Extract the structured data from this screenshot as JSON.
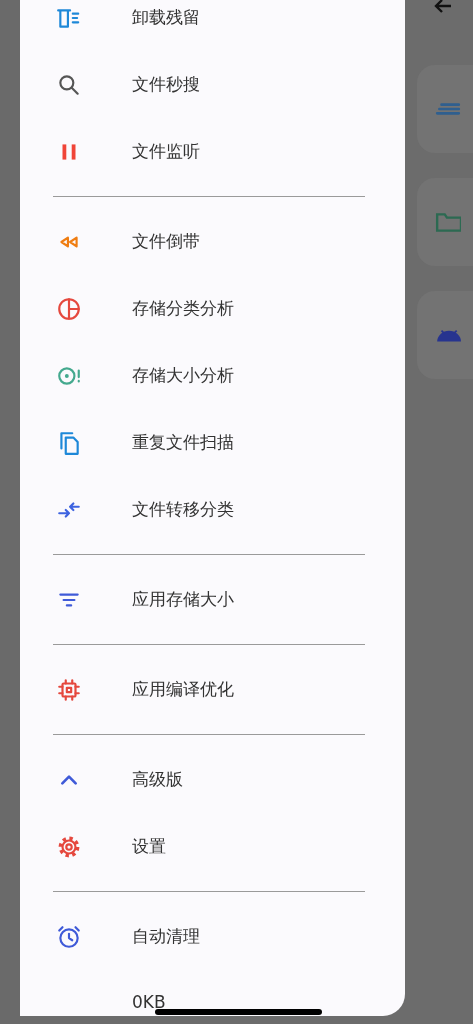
{
  "drawer": {
    "sections": [
      {
        "items": [
          {
            "kind": "uninstall",
            "color": "#1e88d8",
            "label": "卸载残留"
          },
          {
            "kind": "search",
            "color": "#555555",
            "label": "文件秒搜"
          },
          {
            "kind": "pause",
            "color": "#f04438",
            "label": "文件监听"
          }
        ]
      },
      {
        "items": [
          {
            "kind": "rewind",
            "color": "#ef7d12",
            "label": "文件倒带"
          },
          {
            "kind": "pie",
            "color": "#e5483e",
            "label": "存储分类分析"
          },
          {
            "kind": "target",
            "color": "#44a98e",
            "label": "存储大小分析"
          },
          {
            "kind": "copy",
            "color": "#1e88d8",
            "label": "重复文件扫描"
          },
          {
            "kind": "swap",
            "color": "#3d63e0",
            "label": "文件转移分类"
          }
        ]
      },
      {
        "items": [
          {
            "kind": "filter",
            "color": "#3f5ad8",
            "label": "应用存储大小"
          }
        ]
      },
      {
        "items": [
          {
            "kind": "chip",
            "color": "#e5483e",
            "label": "应用编译优化"
          }
        ]
      },
      {
        "items": [
          {
            "kind": "caret",
            "color": "#3f5ad8",
            "label": "高级版"
          },
          {
            "kind": "gear",
            "color": "#e5483e",
            "label": "设置"
          }
        ]
      },
      {
        "items": [
          {
            "kind": "alarm",
            "color": "#3f5ad8",
            "label": "自动清理"
          }
        ]
      }
    ],
    "footer_text": "0KB"
  },
  "background": {
    "cards": [
      {
        "kind": "list",
        "color": "#2f5f8f"
      },
      {
        "kind": "folder",
        "color": "#2c6a52"
      },
      {
        "kind": "android",
        "color": "#27348f"
      }
    ]
  }
}
